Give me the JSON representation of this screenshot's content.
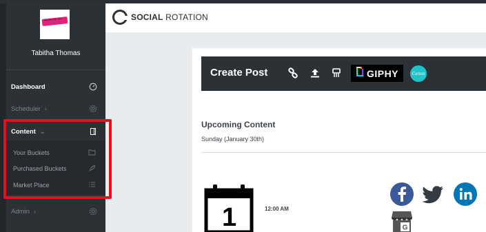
{
  "sidebar": {
    "user_name": "Tabitha Thomas",
    "items": [
      {
        "label": "Dashboard",
        "icon": "gauge-icon"
      },
      {
        "label": "Scheduler",
        "icon": "gear-icon"
      },
      {
        "label": "Content",
        "icon": "book-icon"
      },
      {
        "label": "Admin",
        "icon": "gear-icon"
      }
    ],
    "content_submenu": [
      {
        "label": "Your Buckets",
        "icon": "folder-icon"
      },
      {
        "label": "Purchased Buckets",
        "icon": "rocket-icon"
      },
      {
        "label": "Market Place",
        "icon": "list-icon"
      }
    ],
    "highlight_color": "#e3101c"
  },
  "header": {
    "brand_bold": "SOCIAL",
    "brand_light": "ROTATION"
  },
  "create_post": {
    "title": "Create Post",
    "giphy_label": "GIPHY",
    "canva_label": "Canva",
    "icons": [
      "link-icon",
      "upload-icon",
      "shredder-icon",
      "giphy-icon",
      "canva-icon"
    ]
  },
  "upcoming": {
    "title": "Upcoming Content",
    "date": "Sunday (January 30th)",
    "calendar_day": "1",
    "time": "12:00 AM",
    "networks": [
      "facebook-icon",
      "twitter-icon",
      "linkedin-icon",
      "google-business-icon"
    ]
  },
  "colors": {
    "sidebar": "#2c3136",
    "facebook": "#3b5998",
    "twitter": "#333b42",
    "linkedin": "#0077b5",
    "canva": "#1fc4c8"
  }
}
